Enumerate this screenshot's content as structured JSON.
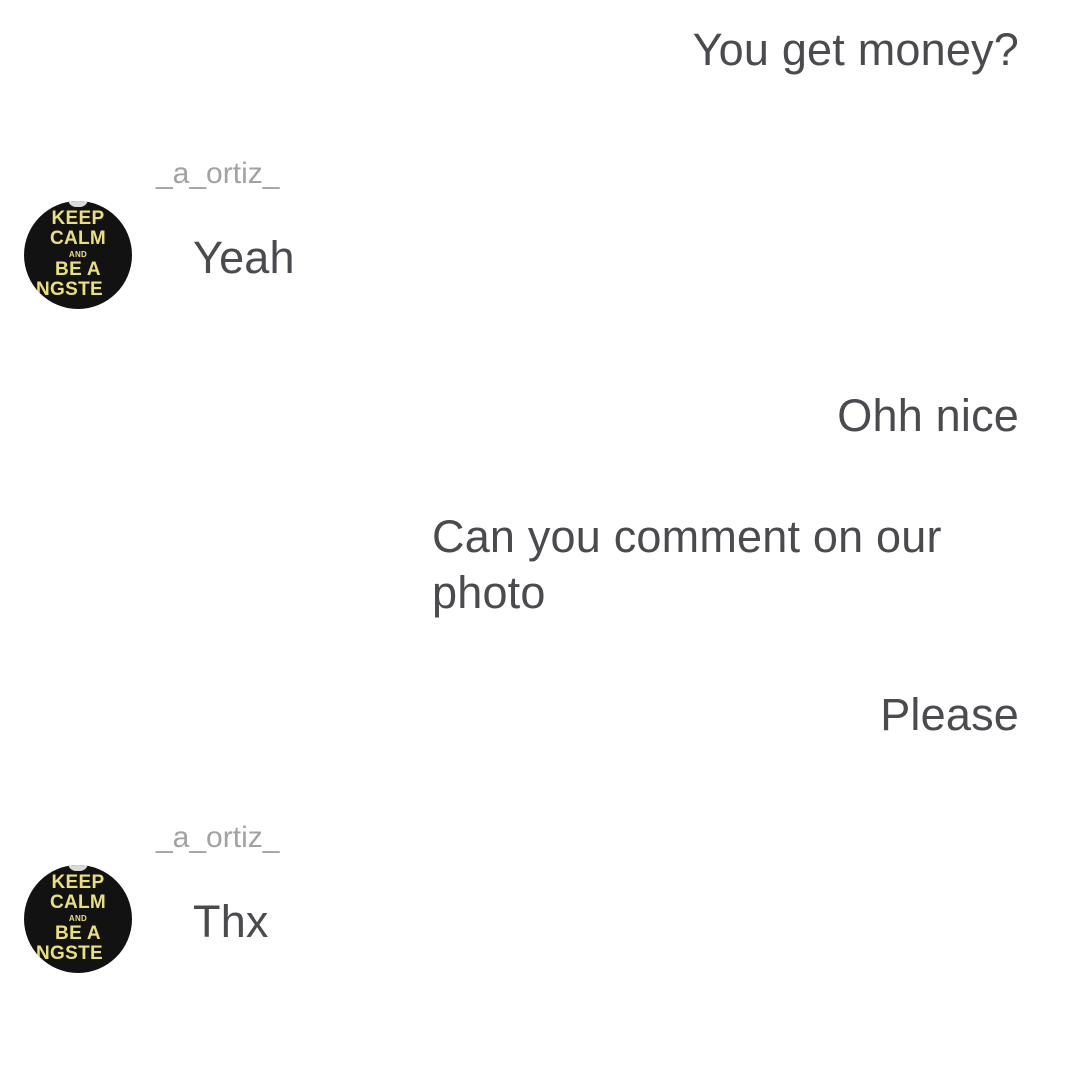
{
  "messages": [
    {
      "direction": "sent",
      "text": "You get money?"
    },
    {
      "direction": "received",
      "username": "_a_ortiz_",
      "text": "Yeah"
    },
    {
      "direction": "sent",
      "text": "Ohh nice"
    },
    {
      "direction": "sent",
      "text": "Can you comment on our photo"
    },
    {
      "direction": "sent",
      "text": "Please"
    },
    {
      "direction": "received",
      "username": "_a_ortiz_",
      "text": "Thx"
    }
  ],
  "avatar": {
    "lines": [
      "KEEP",
      "CALM",
      "AND",
      "BE A",
      "ANGSTE"
    ],
    "background_color": "#121212",
    "text_color": "#e9e07a"
  },
  "colors": {
    "message_text": "#4a4b4e",
    "username_text": "#a2a2a4",
    "background": "#ffffff"
  }
}
